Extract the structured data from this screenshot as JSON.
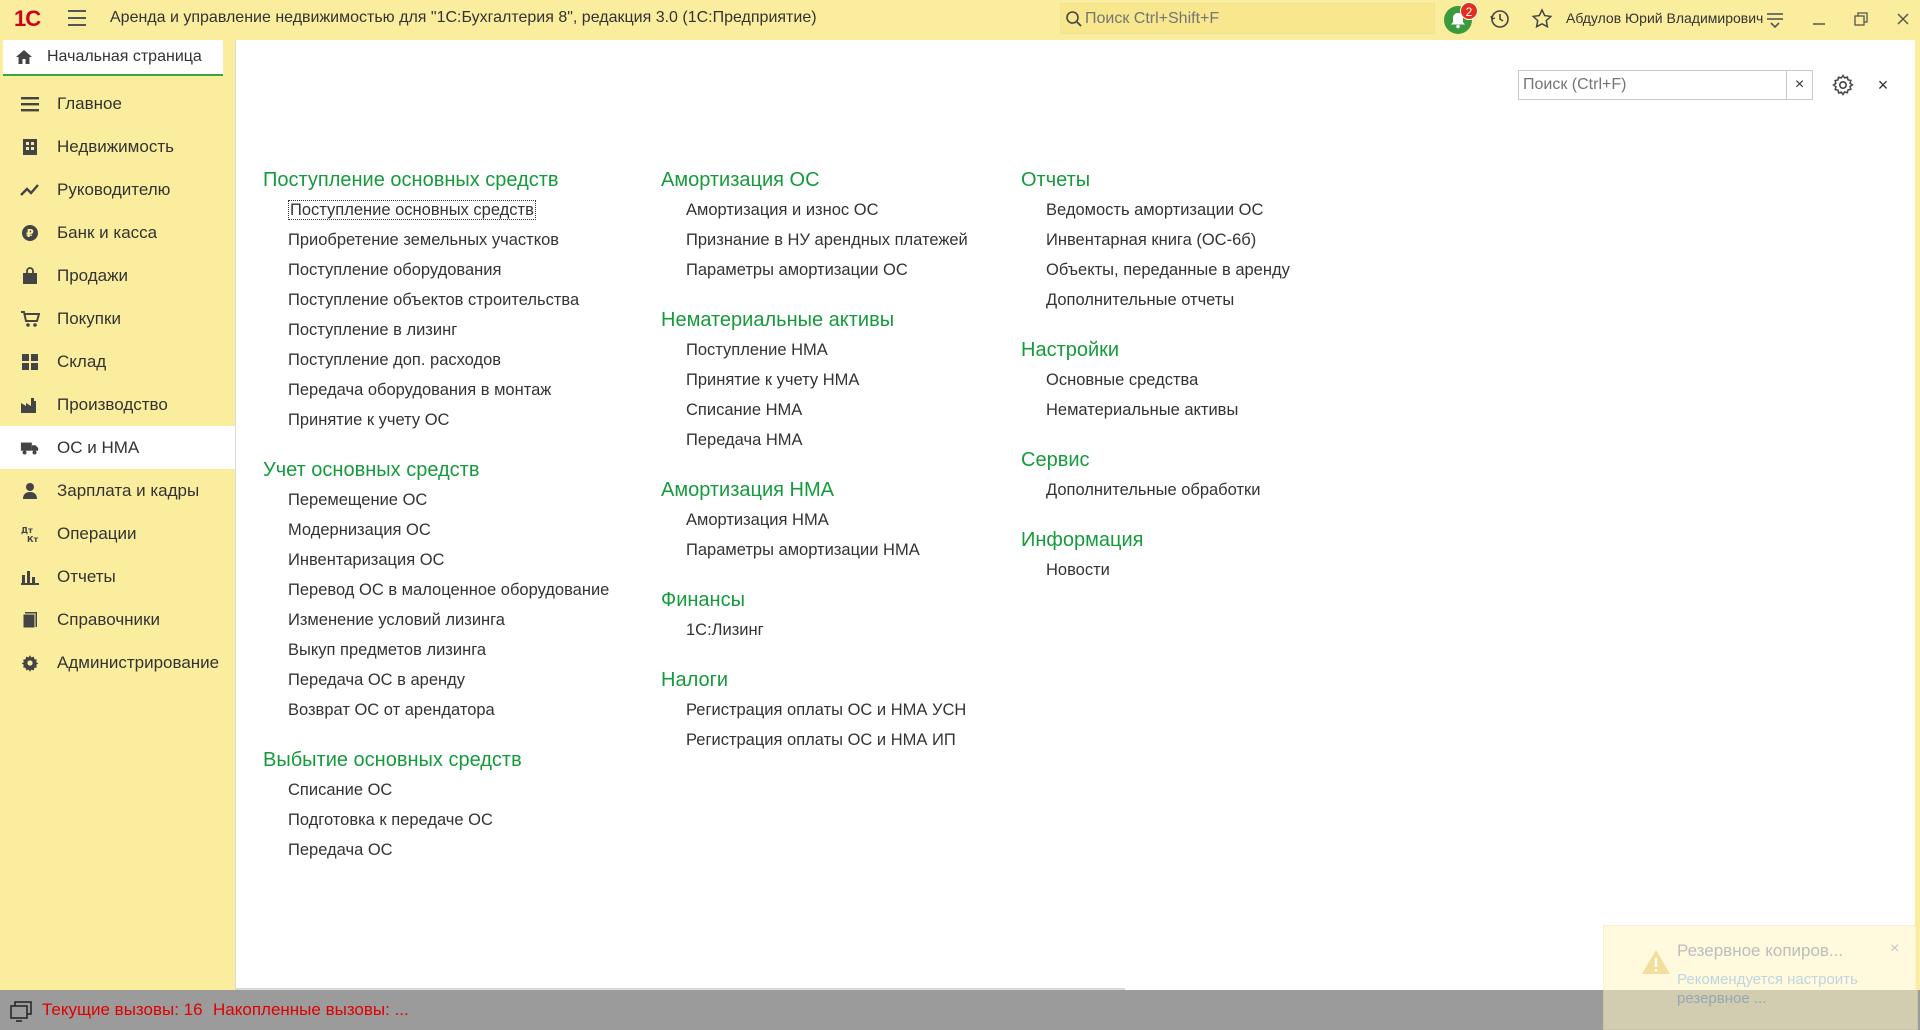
{
  "titlebar": {
    "logo_text": "1С",
    "title": "Аренда и управление недвижимостью для \"1С:Бухгалтерия 8\", редакция 3.0  (1С:Предприятие)",
    "search_placeholder": "Поиск Ctrl+Shift+F",
    "notifications_count": "2",
    "user_name": "Абдулов Юрий Владимирович"
  },
  "home_tab": {
    "label": "Начальная страница"
  },
  "sidebar": {
    "items": [
      {
        "label": "Главное",
        "icon": "list-icon"
      },
      {
        "label": "Недвижимость",
        "icon": "building-icon"
      },
      {
        "label": "Руководителю",
        "icon": "trend-icon"
      },
      {
        "label": "Банк и касса",
        "icon": "coin-icon"
      },
      {
        "label": "Продажи",
        "icon": "bag-icon"
      },
      {
        "label": "Покупки",
        "icon": "cart-icon"
      },
      {
        "label": "Склад",
        "icon": "warehouse-icon"
      },
      {
        "label": "Производство",
        "icon": "factory-icon"
      },
      {
        "label": "ОС и НМА",
        "icon": "truck-icon",
        "active": true
      },
      {
        "label": "Зарплата и кадры",
        "icon": "person-icon"
      },
      {
        "label": "Операции",
        "icon": "dtkt-icon"
      },
      {
        "label": "Отчеты",
        "icon": "bar-chart-icon"
      },
      {
        "label": "Справочники",
        "icon": "book-icon"
      },
      {
        "label": "Администрирование",
        "icon": "gear-icon"
      }
    ]
  },
  "panel": {
    "search_placeholder": "Поиск (Ctrl+F)",
    "clear_label": "×",
    "close_label": "×",
    "columns": [
      [
        {
          "title": "Поступление основных средств",
          "links": [
            "Поступление основных средств",
            "Приобретение земельных участков",
            "Поступление оборудования",
            "Поступление объектов строительства",
            "Поступление в лизинг",
            "Поступление доп. расходов",
            "Передача оборудования в монтаж",
            "Принятие к учету ОС"
          ]
        },
        {
          "title": "Учет основных средств",
          "links": [
            "Перемещение ОС",
            "Модернизация ОС",
            "Инвентаризация ОС",
            "Перевод ОС в малоценное оборудование",
            "Изменение условий лизинга",
            "Выкуп предметов лизинга",
            "Передача ОС в аренду",
            "Возврат ОС от арендатора"
          ]
        },
        {
          "title": "Выбытие основных средств",
          "links": [
            "Списание ОС",
            "Подготовка к передаче ОС",
            "Передача ОС"
          ]
        }
      ],
      [
        {
          "title": "Амортизация ОС",
          "links": [
            "Амортизация и износ ОС",
            "Признание в НУ арендных платежей",
            "Параметры амортизации ОС"
          ]
        },
        {
          "title": "Нематериальные активы",
          "links": [
            "Поступление НМА",
            "Принятие к учету НМА",
            "Списание НМА",
            "Передача НМА"
          ]
        },
        {
          "title": "Амортизация НМА",
          "links": [
            "Амортизация НМА",
            "Параметры амортизации НМА"
          ]
        },
        {
          "title": "Финансы",
          "links": [
            "1С:Лизинг"
          ]
        },
        {
          "title": "Налоги",
          "links": [
            "Регистрация оплаты ОС и НМА УСН",
            "Регистрация оплаты ОС и НМА ИП"
          ]
        }
      ],
      [
        {
          "title": "Отчеты",
          "links": [
            "Ведомость амортизации ОС",
            "Инвентарная книга (ОС-6б)",
            "Объекты, переданные в аренду",
            "Дополнительные отчеты"
          ]
        },
        {
          "title": "Настройки",
          "links": [
            "Основные средства",
            "Нематериальные активы"
          ]
        },
        {
          "title": "Сервис",
          "links": [
            "Дополнительные обработки"
          ]
        },
        {
          "title": "Информация",
          "links": [
            "Новости"
          ]
        }
      ]
    ]
  },
  "statusbar": {
    "current_calls": "Текущие вызовы: 16",
    "accumulated_calls": "Накопленные вызовы: ..."
  },
  "toast": {
    "title": "Резервное копиров...",
    "message": "Рекомендуется настроить резервное ...",
    "close_label": "×"
  },
  "colors": {
    "sidebar_bg": "#fbed9e",
    "group_title": "#169b3c",
    "status_text": "#e00000",
    "status_bg": "#9b9b9b"
  }
}
